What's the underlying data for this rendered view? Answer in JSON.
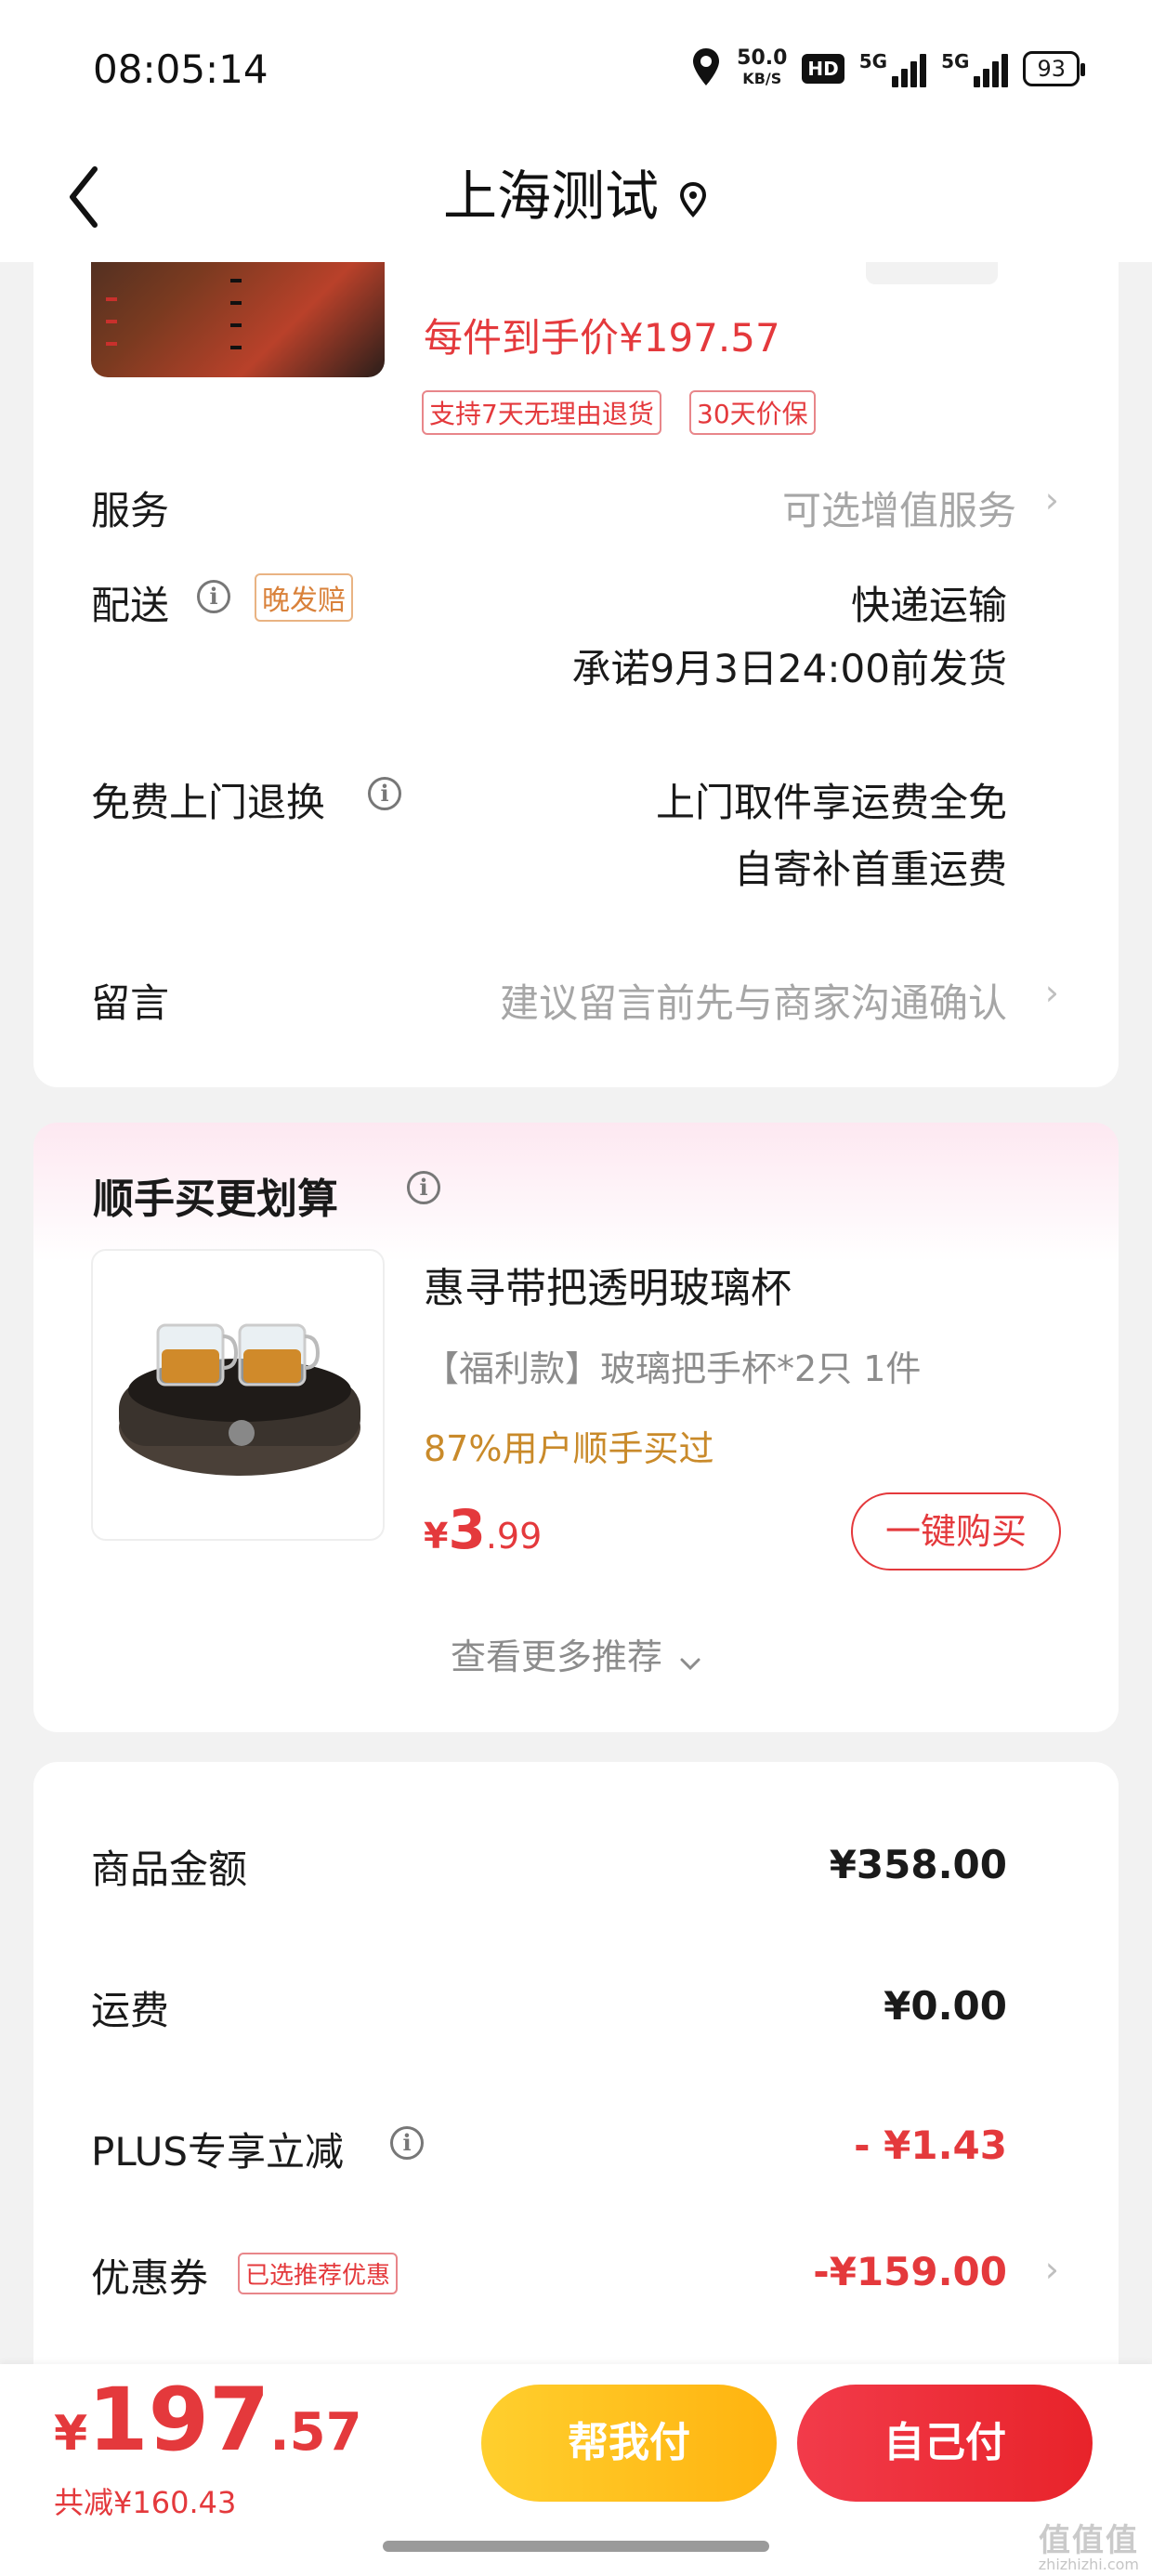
{
  "status_bar": {
    "time": "08:05:14",
    "net_speed_value": "50.0",
    "net_speed_unit": "KB/S",
    "hd_label": "HD",
    "signal1_label": "5G",
    "signal2_label": "5G",
    "battery": "93"
  },
  "nav": {
    "title": "上海测试"
  },
  "order_item": {
    "unit_price_line": "每件到手价¥197.57",
    "tags": [
      "支持7天无理由退货",
      "30天价保"
    ]
  },
  "service": {
    "label": "服务",
    "value": "可选增值服务"
  },
  "delivery": {
    "label": "配送",
    "badge": "晚发赔",
    "method": "快递运输",
    "promise": "承诺9月3日24:00前发货"
  },
  "free_return": {
    "label": "免费上门退换",
    "line1": "上门取件享运费全免",
    "line2": "自寄补首重运费"
  },
  "message": {
    "label": "留言",
    "placeholder": "建议留言前先与商家沟通确认"
  },
  "addon": {
    "title": "顺手买更划算",
    "product_name": "惠寻带把透明玻璃杯",
    "spec": "【福利款】玻璃把手杯*2只 1件",
    "stat": "87%用户顺手买过",
    "price_symbol": "¥",
    "price_int": "3",
    "price_dec": ".99",
    "buy_button": "一键购买",
    "more": "查看更多推荐"
  },
  "summary": {
    "amount_label": "商品金额",
    "amount_value": "¥358.00",
    "shipping_label": "运费",
    "shipping_value": "¥0.00",
    "plus_label": "PLUS专享立减",
    "plus_value": "- ¥1.43",
    "coupon_label": "优惠券",
    "coupon_badge": "已选推荐优惠",
    "coupon_value": "-¥159.00"
  },
  "bottom": {
    "total_symbol": "¥",
    "total_int": "197",
    "total_dec": ".57",
    "saved": "共减¥160.43",
    "help_pay": "帮我付",
    "self_pay": "自己付"
  },
  "watermark": {
    "text": "值值值",
    "sub": "zhizhizhi.com"
  },
  "colors": {
    "accent_red": "#e4393c",
    "pay_yellow": "#ffb30f",
    "gold_text": "#c98a2a",
    "page_bg": "#f2f2f2"
  }
}
